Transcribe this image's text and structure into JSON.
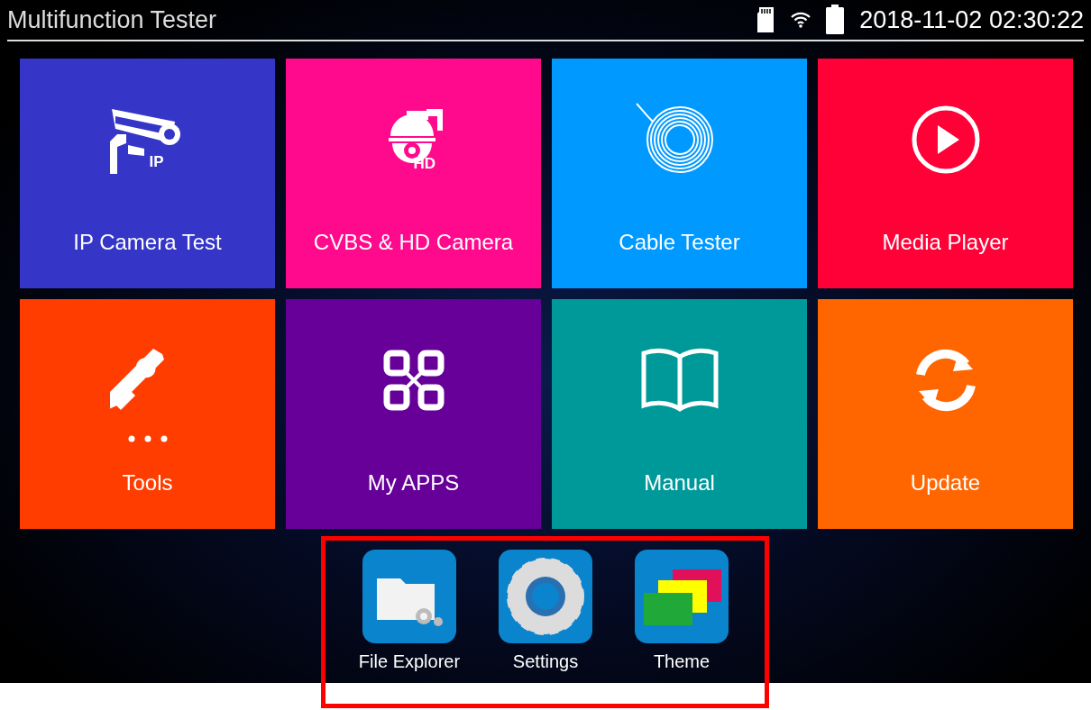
{
  "status_bar": {
    "title": "Multifunction Tester",
    "datetime": "2018-11-02 02:30:22"
  },
  "tiles": [
    {
      "label": "IP Camera Test",
      "color": "#3535c8",
      "icon_text": "IP"
    },
    {
      "label": "CVBS & HD Camera",
      "color": "#ff0a8c",
      "icon_text": "HD"
    },
    {
      "label": "Cable Tester",
      "color": "#0099ff"
    },
    {
      "label": "Media Player",
      "color": "#ff0037"
    },
    {
      "label": "Tools",
      "color": "#ff3d00"
    },
    {
      "label": "My APPS",
      "color": "#660099"
    },
    {
      "label": "Manual",
      "color": "#009999"
    },
    {
      "label": "Update",
      "color": "#ff6600"
    }
  ],
  "dock": {
    "highlighted": true,
    "items": [
      {
        "label": "File Explorer"
      },
      {
        "label": "Settings"
      },
      {
        "label": "Theme"
      }
    ]
  }
}
